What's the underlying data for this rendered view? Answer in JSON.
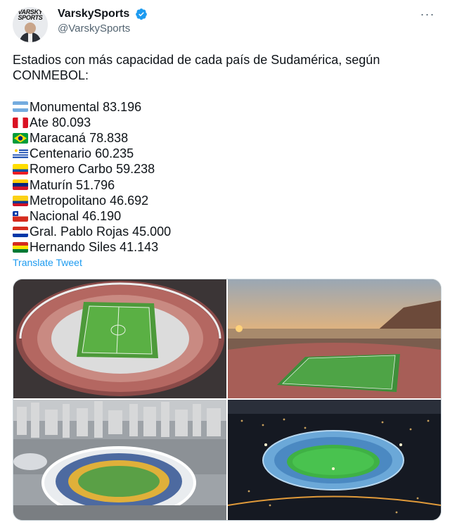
{
  "author": {
    "display_name": "VarskySports",
    "handle": "@VarskySports",
    "avatar_text": "VARSKY SPORTS",
    "verified": true
  },
  "menu": {
    "more_label": "···"
  },
  "tweet": {
    "intro": "Estadios con más capacidad de cada país de Sudamérica, según CONMEBOL:",
    "stadiums": [
      {
        "flag": "argentina-flag",
        "name": "Monumental",
        "capacity": "83.196"
      },
      {
        "flag": "peru-flag",
        "name": "Ate",
        "capacity": "80.093"
      },
      {
        "flag": "brazil-flag",
        "name": "Maracaná",
        "capacity": "78.838"
      },
      {
        "flag": "uruguay-flag",
        "name": "Centenario",
        "capacity": "60.235"
      },
      {
        "flag": "ecuador-flag",
        "name": "Romero Carbo",
        "capacity": "59.238"
      },
      {
        "flag": "venezuela-flag",
        "name": "Maturín",
        "capacity": "51.796"
      },
      {
        "flag": "colombia-flag",
        "name": "Metropolitano",
        "capacity": "46.692"
      },
      {
        "flag": "chile-flag",
        "name": "Nacional",
        "capacity": "46.190"
      },
      {
        "flag": "paraguay-flag",
        "name": "Gral. Pablo Rojas",
        "capacity": "45.000"
      },
      {
        "flag": "bolivia-flag",
        "name": "Hernando Siles",
        "capacity": "41.143"
      }
    ],
    "translate_label": "Translate Tweet"
  },
  "colors": {
    "link": "#1d9bf0",
    "verified": "#1d9bf0",
    "text": "#0f1419",
    "muted": "#536471"
  },
  "media": [
    {
      "icon": "stadium-aerial-photo"
    },
    {
      "icon": "stadium-sunset-photo"
    },
    {
      "icon": "stadium-city-photo"
    },
    {
      "icon": "stadium-night-photo"
    }
  ]
}
